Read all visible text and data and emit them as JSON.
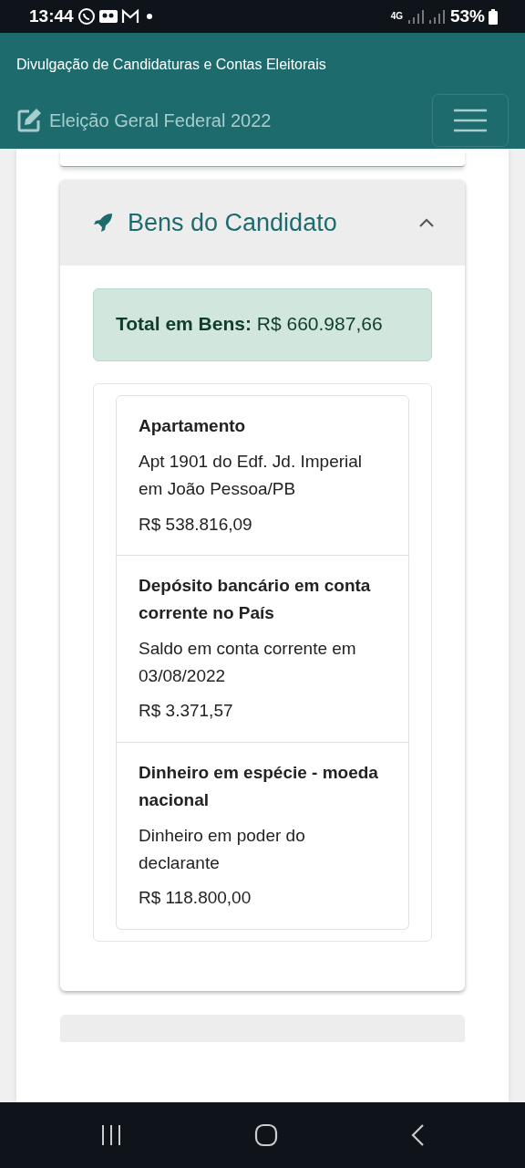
{
  "status_bar": {
    "time": "13:44",
    "network": "4G",
    "battery": "53%"
  },
  "navbar": {
    "subtitle": "Divulgação de Candidaturas e Contas Eleitorais",
    "brand": "Eleição Geral Federal 2022"
  },
  "section": {
    "title": "Bens do Candidato",
    "expanded": true,
    "total": {
      "label": "Total em Bens:",
      "value": "R$ 660.987,66"
    },
    "assets": [
      {
        "type": "Apartamento",
        "description": "Apt 1901 do Edf. Jd. Imperial em João Pessoa/PB",
        "value": "R$ 538.816,09"
      },
      {
        "type": "Depósito bancário em conta corrente no País",
        "description": "Saldo em conta corrente em 03/08/2022",
        "value": "R$ 3.371,57"
      },
      {
        "type": "Dinheiro em espécie - moeda nacional",
        "description": "Dinheiro em poder do declarante",
        "value": "R$ 118.800,00"
      }
    ]
  }
}
